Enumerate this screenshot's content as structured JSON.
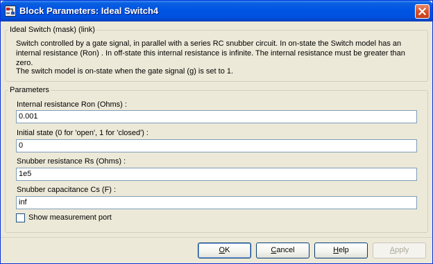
{
  "window": {
    "title": "Block Parameters: Ideal Switch4"
  },
  "description_group": {
    "legend": "Ideal Switch (mask) (link)",
    "paragraph1": "Switch controlled by a gate signal, in parallel with a series RC snubber circuit. In on-state the Switch model has an internal resistance (Ron) . In off-state this internal resistance is infinite. The internal resistance must be greater than zero.",
    "paragraph2": "The switch model is on-state when the gate signal (g) is set to 1."
  },
  "parameters_group": {
    "legend": "Parameters",
    "fields": [
      {
        "label": "Internal resistance Ron (Ohms) :",
        "value": "0.001"
      },
      {
        "label": "Initial state (0 for 'open', 1 for 'closed') :",
        "value": "0"
      },
      {
        "label": "Snubber resistance Rs (Ohms) :",
        "value": "1e5"
      },
      {
        "label": "Snubber capacitance Cs (F) :",
        "value": "inf"
      }
    ],
    "checkbox": {
      "label": "Show measurement port",
      "checked": false
    }
  },
  "buttons": {
    "ok_first": "O",
    "ok_rest": "K",
    "cancel_first": "C",
    "cancel_rest": "ancel",
    "help_first": "H",
    "help_rest": "elp",
    "apply_first": "A",
    "apply_rest": "pply"
  },
  "icons": {
    "app": "simulink-block-icon",
    "close": "close-icon"
  },
  "colors": {
    "titlebar": "#0054e3",
    "close_button": "#d6512c",
    "dialog_background": "#ece9d8"
  }
}
